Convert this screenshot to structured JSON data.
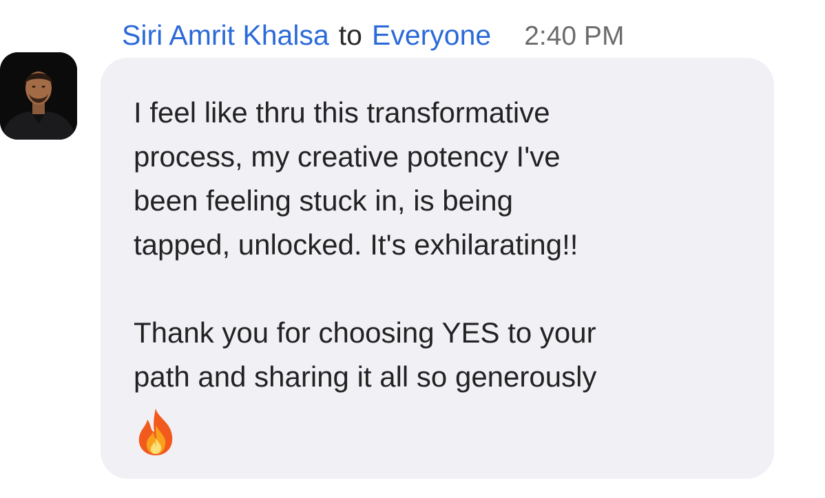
{
  "message": {
    "sender": "Siri Amrit Khalsa",
    "to_label": "to",
    "recipient": "Everyone",
    "time": "2:40 PM",
    "paragraphs": [
      [
        "I feel like thru this transformative",
        "process, my creative potency I've",
        "been feeling stuck in, is being",
        "tapped, unlocked. It's exhilarating!!"
      ],
      [
        "Thank you for choosing YES to your",
        "path and sharing it all so generously"
      ]
    ],
    "emoji": "fire-icon"
  },
  "colors": {
    "name": "#2b6ad8",
    "bubble": "#f0f0f5",
    "text": "#222222",
    "time": "#6b6b6b"
  }
}
